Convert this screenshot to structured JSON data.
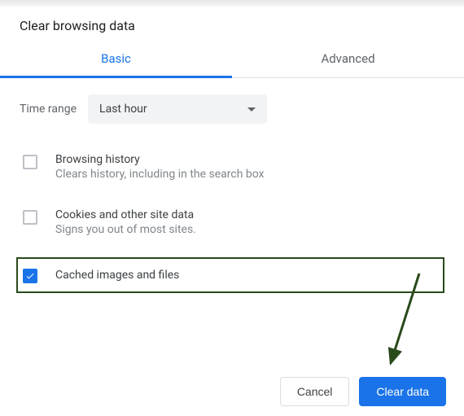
{
  "title": "Clear browsing data",
  "tabs": {
    "basic": "Basic",
    "advanced": "Advanced"
  },
  "time_range": {
    "label": "Time range",
    "value": "Last hour"
  },
  "options": [
    {
      "title": "Browsing history",
      "sub": "Clears history, including in the search box",
      "checked": false
    },
    {
      "title": "Cookies and other site data",
      "sub": "Signs you out of most sites.",
      "checked": false
    },
    {
      "title": "Cached images and files",
      "sub": "",
      "checked": true
    }
  ],
  "buttons": {
    "cancel": "Cancel",
    "clear": "Clear data"
  }
}
